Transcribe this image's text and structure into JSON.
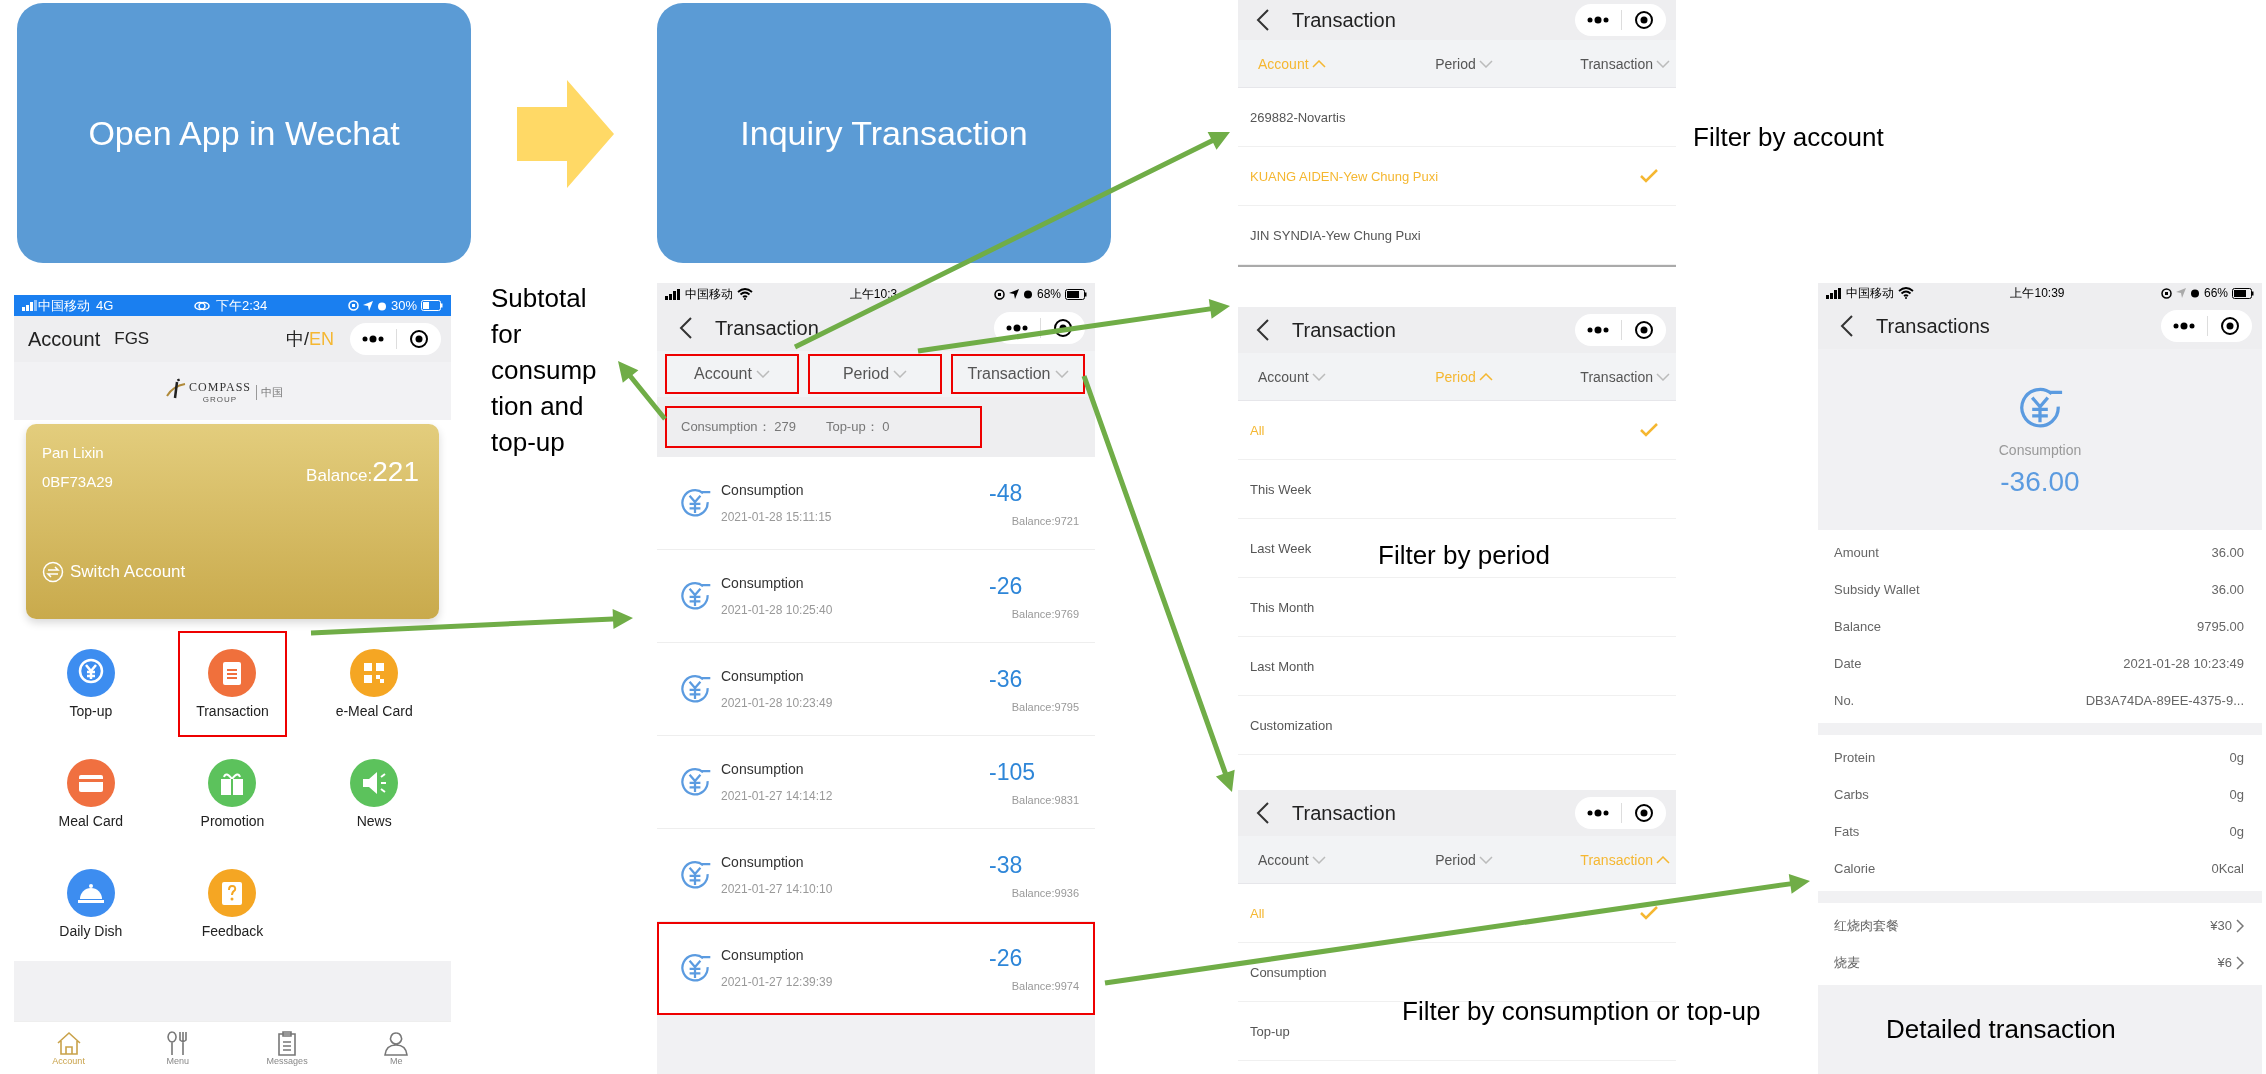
{
  "flow_steps": [
    {
      "label": "Open App in Wechat"
    },
    {
      "label": "Inquiry Transaction"
    }
  ],
  "home_screen": {
    "status_bar": {
      "carrier": "中国移动",
      "network": "4G",
      "time": "下午2:34",
      "battery": "30%"
    },
    "header": {
      "title": "Account",
      "org": "FGS",
      "languages": [
        {
          "label": "中",
          "selected": false
        },
        {
          "label": "EN",
          "selected": true
        }
      ],
      "separator": "/"
    },
    "logo": {
      "name": "COMPASS",
      "sub": "GROUP",
      "region": "中国"
    },
    "card": {
      "holder": "Pan Lixin",
      "card_no": "0BF73A29",
      "balance_label": "Balance:",
      "balance": "221",
      "switch_label": "Switch Account"
    },
    "menu": [
      {
        "label": "Top-up",
        "kind": "topup",
        "color": "#3d8df0",
        "highlighted": false
      },
      {
        "label": "Transaction",
        "kind": "receipt",
        "color": "#f0703c",
        "highlighted": true
      },
      {
        "label": "e-Meal Card",
        "kind": "qr",
        "color": "#f5a623",
        "highlighted": false
      },
      {
        "label": "Meal Card",
        "kind": "card",
        "color": "#f07040",
        "highlighted": false
      },
      {
        "label": "Promotion",
        "kind": "gift",
        "color": "#5cc25c",
        "highlighted": false
      },
      {
        "label": "News",
        "kind": "speaker",
        "color": "#5cc25c",
        "highlighted": false
      },
      {
        "label": "Daily Dish",
        "kind": "cloche",
        "color": "#3d8df0",
        "highlighted": false
      },
      {
        "label": "Feedback",
        "kind": "question",
        "color": "#f5a623",
        "highlighted": false
      }
    ],
    "tab_bar": [
      {
        "label": "Account",
        "kind": "home",
        "selected": true
      },
      {
        "label": "Menu",
        "kind": "cutlery",
        "selected": false
      },
      {
        "label": "Messages",
        "kind": "clipboard",
        "selected": false
      },
      {
        "label": "Me",
        "kind": "person",
        "selected": false
      }
    ]
  },
  "subtotal_note": "Subtotal for consumption and top-up",
  "list_screen": {
    "status_bar": {
      "carrier": "中国移动",
      "time": "上午10:3",
      "battery": "68%"
    },
    "title": "Transaction",
    "filters": [
      {
        "label": "Account",
        "open": false,
        "highlighted": true
      },
      {
        "label": "Period",
        "open": false,
        "highlighted": true
      },
      {
        "label": "Transaction",
        "open": false,
        "highlighted": true
      }
    ],
    "summary": {
      "consumption_label": "Consumption：",
      "consumption": "279",
      "topup_label": "Top-up：",
      "topup": "0",
      "highlighted": true
    },
    "rows": [
      {
        "type": "Consumption",
        "date": "2021-01-28 15:11:15",
        "amount": "-48",
        "balance": "Balance:9721",
        "highlighted": false
      },
      {
        "type": "Consumption",
        "date": "2021-01-28 10:25:40",
        "amount": "-26",
        "balance": "Balance:9769",
        "highlighted": false
      },
      {
        "type": "Consumption",
        "date": "2021-01-28 10:23:49",
        "amount": "-36",
        "balance": "Balance:9795",
        "highlighted": false
      },
      {
        "type": "Consumption",
        "date": "2021-01-27 14:14:12",
        "amount": "-105",
        "balance": "Balance:9831",
        "highlighted": false
      },
      {
        "type": "Consumption",
        "date": "2021-01-27 14:10:10",
        "amount": "-38",
        "balance": "Balance:9936",
        "highlighted": false
      },
      {
        "type": "Consumption",
        "date": "2021-01-27 12:39:39",
        "amount": "-26",
        "balance": "Balance:9974",
        "highlighted": true
      }
    ]
  },
  "filter_screens": [
    {
      "title": "Transaction",
      "filters": [
        {
          "label": "Account",
          "open": true
        },
        {
          "label": "Period",
          "open": false
        },
        {
          "label": "Transaction",
          "open": false
        }
      ],
      "options": [
        {
          "label": "269882-Novartis",
          "selected": false
        },
        {
          "label": "KUANG AIDEN-Yew Chung Puxi",
          "selected": true
        },
        {
          "label": "JIN SYNDIA-Yew Chung Puxi",
          "selected": false
        }
      ]
    },
    {
      "title": "Transaction",
      "filters": [
        {
          "label": "Account",
          "open": false
        },
        {
          "label": "Period",
          "open": true
        },
        {
          "label": "Transaction",
          "open": false
        }
      ],
      "options": [
        {
          "label": "All",
          "selected": true
        },
        {
          "label": "This Week",
          "selected": false
        },
        {
          "label": "Last Week",
          "selected": false
        },
        {
          "label": "This Month",
          "selected": false
        },
        {
          "label": "Last Month",
          "selected": false
        },
        {
          "label": "Customization",
          "selected": false
        }
      ]
    },
    {
      "title": "Transaction",
      "filters": [
        {
          "label": "Account",
          "open": false
        },
        {
          "label": "Period",
          "open": false
        },
        {
          "label": "Transaction",
          "open": true
        }
      ],
      "options": [
        {
          "label": "All",
          "selected": true
        },
        {
          "label": "Consumption",
          "selected": false
        },
        {
          "label": "Top-up",
          "selected": false
        }
      ]
    }
  ],
  "detail_screen": {
    "status_bar": {
      "carrier": "中国移动",
      "time": "上午10:39",
      "battery": "66%"
    },
    "title": "Transactions",
    "type": "Consumption",
    "amount": "-36.00",
    "details": [
      {
        "label": "Amount",
        "value": "36.00"
      },
      {
        "label": "Subsidy Wallet",
        "value": "36.00"
      },
      {
        "label": "Balance",
        "value": "9795.00"
      },
      {
        "label": "Date",
        "value": "2021-01-28 10:23:49"
      },
      {
        "label": "No.",
        "value": "DB3A74DA-89EE-4375-9..."
      }
    ],
    "nutrition": [
      {
        "label": "Protein",
        "value": "0g"
      },
      {
        "label": "Carbs",
        "value": "0g"
      },
      {
        "label": "Fats",
        "value": "0g"
      },
      {
        "label": "Calorie",
        "value": "0Kcal"
      }
    ],
    "items": [
      {
        "name": "红烧肉套餐",
        "price": "¥30"
      },
      {
        "name": "烧麦",
        "price": "¥6"
      }
    ]
  },
  "captions": [
    "Filter by account",
    "Filter by period",
    "Filter by consumption or top-up",
    "Detailed transaction"
  ]
}
